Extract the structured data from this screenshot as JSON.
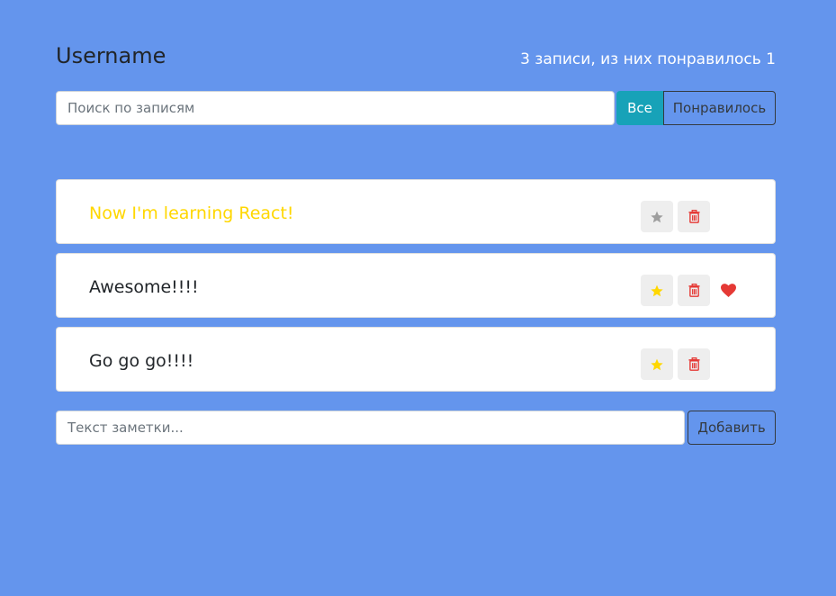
{
  "header": {
    "username": "Username",
    "stats": "3 записи, из них понравилось 1"
  },
  "search": {
    "placeholder": "Поиск по записям",
    "value": ""
  },
  "filter": {
    "all_label": "Все",
    "liked_label": "Понравилось",
    "active": "all"
  },
  "posts": [
    {
      "label": "Now I'm learning React!",
      "important": true,
      "liked": false
    },
    {
      "label": "Awesome!!!!",
      "important": false,
      "liked": true
    },
    {
      "label": "Go go go!!!!",
      "important": false,
      "liked": false
    }
  ],
  "add_form": {
    "placeholder": "Текст заметки...",
    "value": "",
    "button_label": "Добавить"
  },
  "icons": {
    "star": "star-icon",
    "trash": "trash-icon",
    "heart": "heart-icon"
  },
  "colors": {
    "background": "#6495ed",
    "important_text": "#ffd700",
    "star_active": "#ffd700",
    "star_inactive": "#9e9e9e",
    "trash": "#e53935",
    "heart": "#e53935",
    "filter_active": "#17a2b8"
  }
}
